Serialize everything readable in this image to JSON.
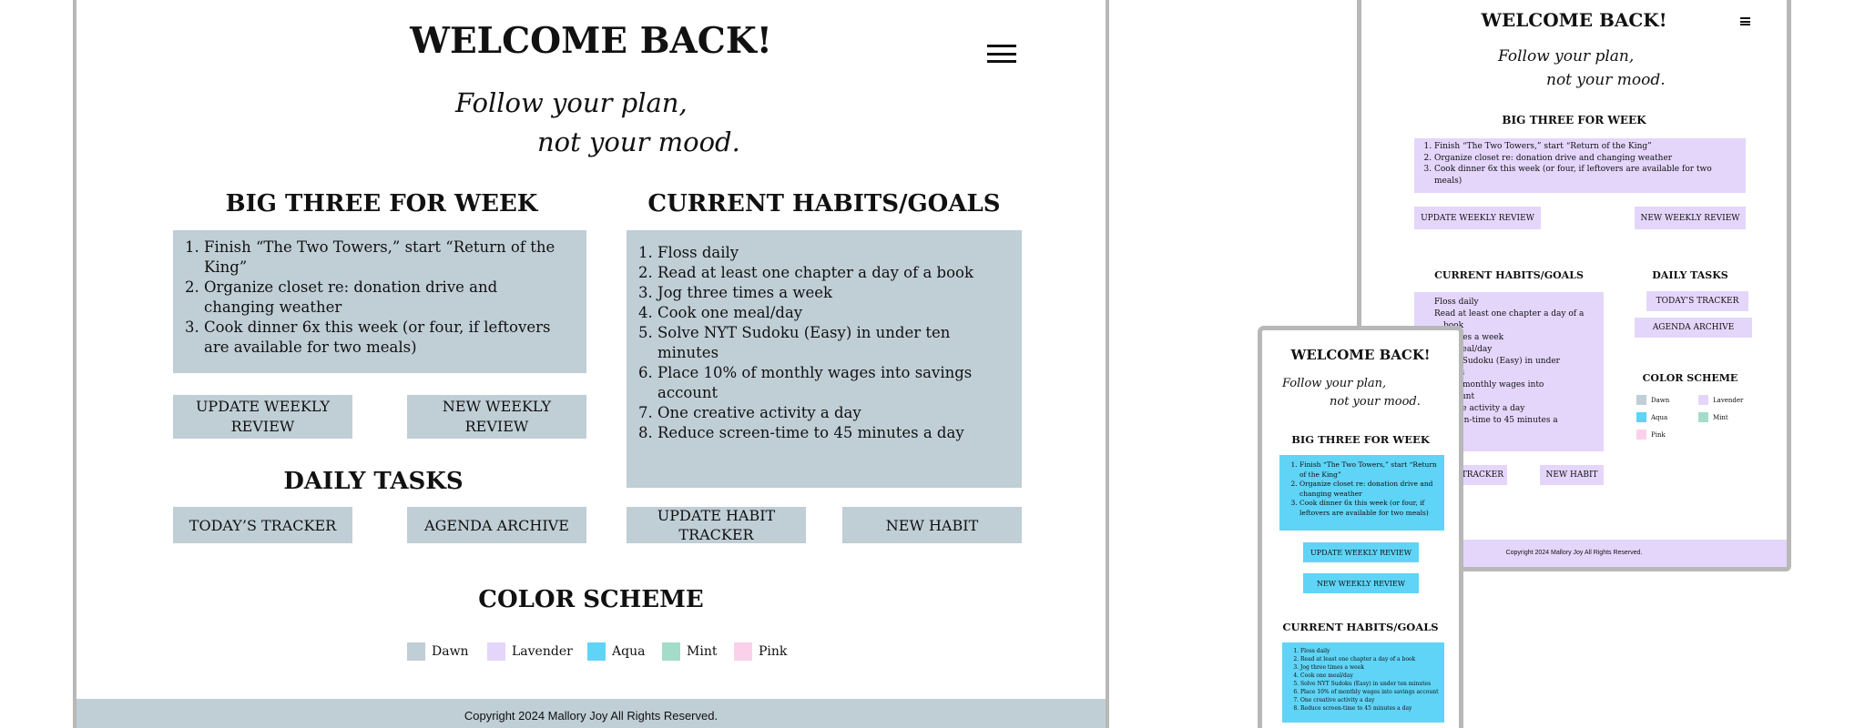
{
  "colors": {
    "dawn": "#c0ced6",
    "lavender": "#e4d6fb",
    "aqua": "#5fd4f6",
    "mint": "#a4dcca",
    "pink": "#fbd1ea",
    "frame_border": "#b8b8b8"
  },
  "header": {
    "title": "WELCOME BACK!",
    "tagline_1": "Follow your plan,",
    "tagline_2": "not your mood.",
    "menu_icon": "hamburger-menu-icon"
  },
  "big_three": {
    "heading": "BIG THREE FOR WEEK",
    "items": [
      "Finish “The Two Towers,” start “Return of the King”",
      "Organize closet re: donation drive and changing weather",
      "Cook dinner 6x this week (or four, if leftovers are available for two meals)"
    ],
    "update_label": "UPDATE WEEKLY REVIEW",
    "new_label": "NEW WEEKLY REVIEW"
  },
  "habits": {
    "heading": "CURRENT HABITS/GOALS",
    "items": [
      "Floss daily",
      "Read at least one chapter a day of a book",
      "Jog three times a week",
      "Cook one meal/day",
      "Solve NYT Sudoku (Easy) in under ten minutes",
      "Place 10% of monthly wages into savings account",
      "One creative activity a day",
      "Reduce screen-time to 45 minutes a day"
    ],
    "update_label": "UPDATE HABIT TRACKER",
    "new_label": "NEW HABIT"
  },
  "tablet_habits": {
    "lines": [
      "Floss daily",
      "Read at least one chapter a day of a",
      "book",
      "e times a week",
      "he meal/day",
      "NYT Sudoku (Easy) in under",
      "nutes",
      "% of monthly wages into",
      "account",
      "eative activity a day",
      "screen-time to 45 minutes a"
    ],
    "tracker_partial": "ABIT TRACKER"
  },
  "daily": {
    "heading": "DAILY TASKS",
    "tracker_label": "TODAY’S TRACKER",
    "archive_label": "AGENDA ARCHIVE"
  },
  "colorscheme": {
    "heading": "COLOR SCHEME",
    "items": [
      "Dawn",
      "Lavender",
      "Aqua",
      "Mint",
      "Pink"
    ]
  },
  "footer": {
    "text": "Copyright 2024 Mallory Joy All Rights Reserved."
  }
}
